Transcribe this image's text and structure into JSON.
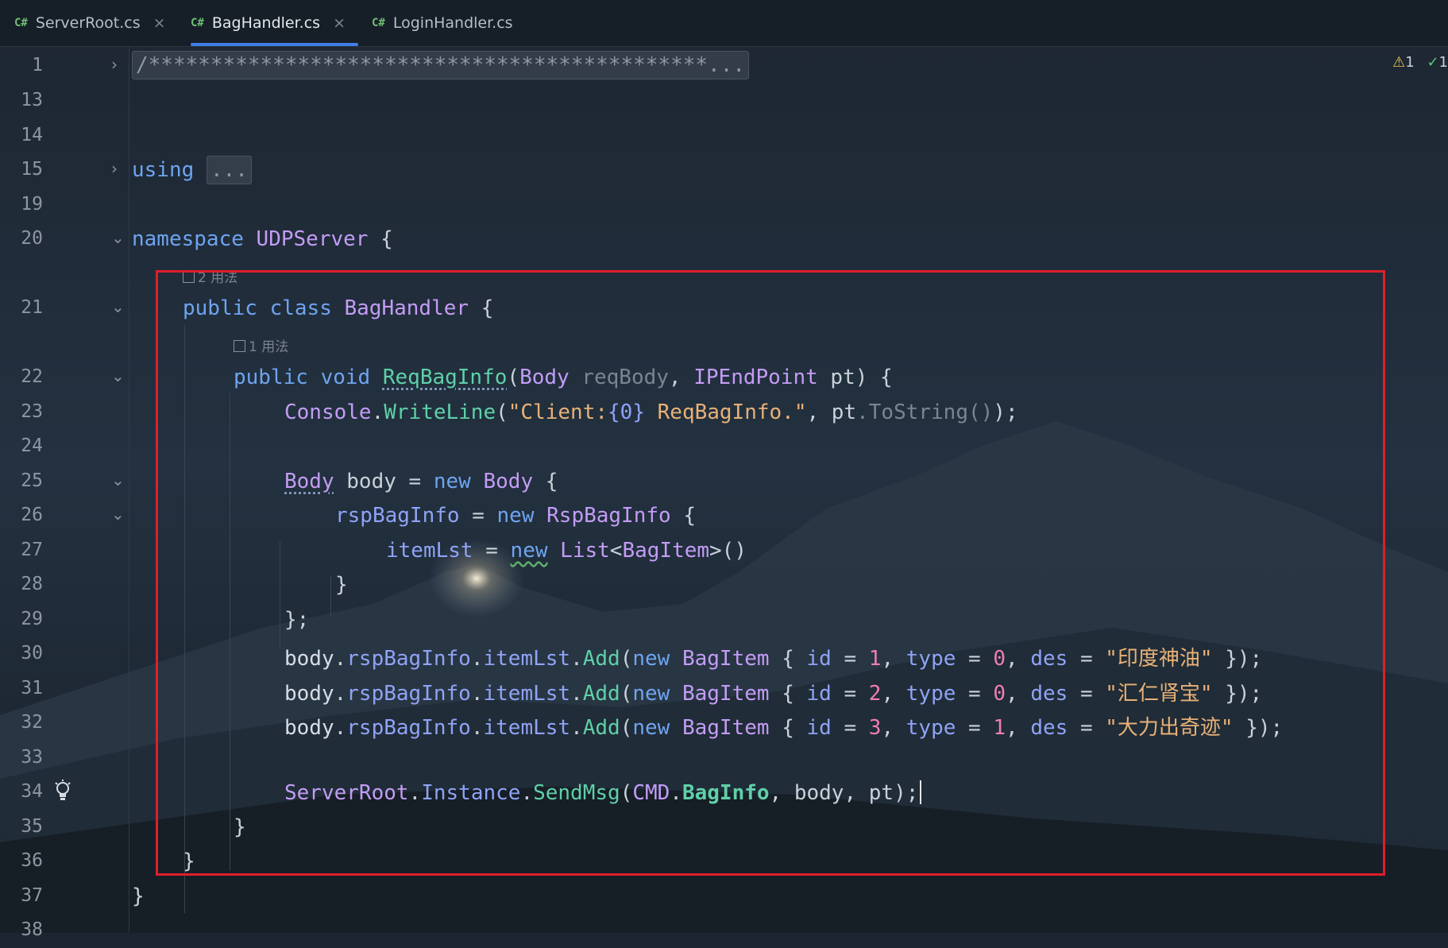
{
  "tabs": [
    {
      "lang": "C#",
      "name": "ServerRoot.cs",
      "close": "×"
    },
    {
      "lang": "C#",
      "name": "BagHandler.cs",
      "close": "×"
    },
    {
      "lang": "C#",
      "name": "LoginHandler.cs"
    }
  ],
  "inspections": {
    "warnings": "1",
    "ok": "1"
  },
  "hints": {
    "class_usages": "2 用法",
    "method_usages": "1 用法"
  },
  "line_numbers": [
    "1",
    "13",
    "14",
    "15",
    "19",
    "20",
    "21",
    "22",
    "23",
    "24",
    "25",
    "26",
    "27",
    "28",
    "29",
    "30",
    "31",
    "32",
    "33",
    "34",
    "35",
    "36",
    "37",
    "38"
  ],
  "code": {
    "l1": "/*********************************************...",
    "l15_kw": "using",
    "l15_fold": "...",
    "l20_kw": "namespace",
    "l20_name": "UDPServer",
    "l20_brace": " {",
    "l21_public": "public",
    "l21_class": "class",
    "l21_name": "BagHandler",
    "l21_brace": " {",
    "l22_public": "public",
    "l22_void": "void",
    "l22_method": "ReqBagInfo",
    "l22_p1": "(",
    "l22_t1": "Body",
    "l22_a1": "reqBody",
    "l22_comma": ", ",
    "l22_t2": "IPEndPoint",
    "l22_a2": " pt) {",
    "l23_t": "Console",
    "l23_dot": ".",
    "l23_m": "WriteLine",
    "l23_open": "(",
    "l23_s1": "\"Client:",
    "l23_fmt": "{0}",
    "l23_s2": " ReqBagInfo.\"",
    "l23_mid": ", pt",
    "l23_g": ".ToString()",
    "l23_end": ");",
    "l25_t": "Body",
    "l25_v": " body = ",
    "l25_new": "new",
    "l25_t2": "Body",
    "l25_b": " {",
    "l26_p": "rspBagInfo",
    "l26_eq": " = ",
    "l26_new": "new",
    "l26_t": "RspBagInfo",
    "l26_b": " {",
    "l27_p": "itemLst",
    "l27_eq": " = ",
    "l27_new": "new",
    "l27_t": "List",
    "l27_lt": "<",
    "l27_t2": "BagItem",
    "l27_gt": ">()",
    "l28": "}",
    "l29": "};",
    "add_body": "body",
    "add_dot": ".",
    "add_p1": "rspBagInfo",
    "add_p2": "itemLst",
    "add_m": "Add",
    "add_open": "(",
    "add_new": "new",
    "add_t": "BagItem",
    "add_lb": " { ",
    "add_id": "id",
    "add_eq": " = ",
    "add_comma": ", ",
    "add_type": "type",
    "add_des": "des",
    "add_end": " });",
    "l30_id": "1",
    "l30_type": "0",
    "l30_des": "\"印度神油\"",
    "l31_id": "2",
    "l31_type": "0",
    "l31_des": "\"汇仁肾宝\"",
    "l32_id": "3",
    "l32_type": "1",
    "l32_des": "\"大力出奇迹\"",
    "l34_t": "ServerRoot",
    "l34_p": "Instance",
    "l34_m": "SendMsg",
    "l34_open": "(",
    "l34_t2": "CMD",
    "l34_c": "BagInfo",
    "l34_rest": ", body, pt);",
    "close_brace": "}"
  },
  "colors": {
    "keyword": "#6ea4f0",
    "type": "#c39cf5",
    "method": "#5fd0a8",
    "string": "#e8b177",
    "number": "#ef7fb0",
    "property": "#8fa3f6",
    "highlight_border": "#e01e2a",
    "active_tab_underline": "#3f7ee8"
  },
  "icons": [
    "csharp-file-icon",
    "close-icon",
    "usages-icon",
    "warning-icon",
    "check-icon",
    "lightbulb-icon",
    "fold-arrow-icon"
  ]
}
